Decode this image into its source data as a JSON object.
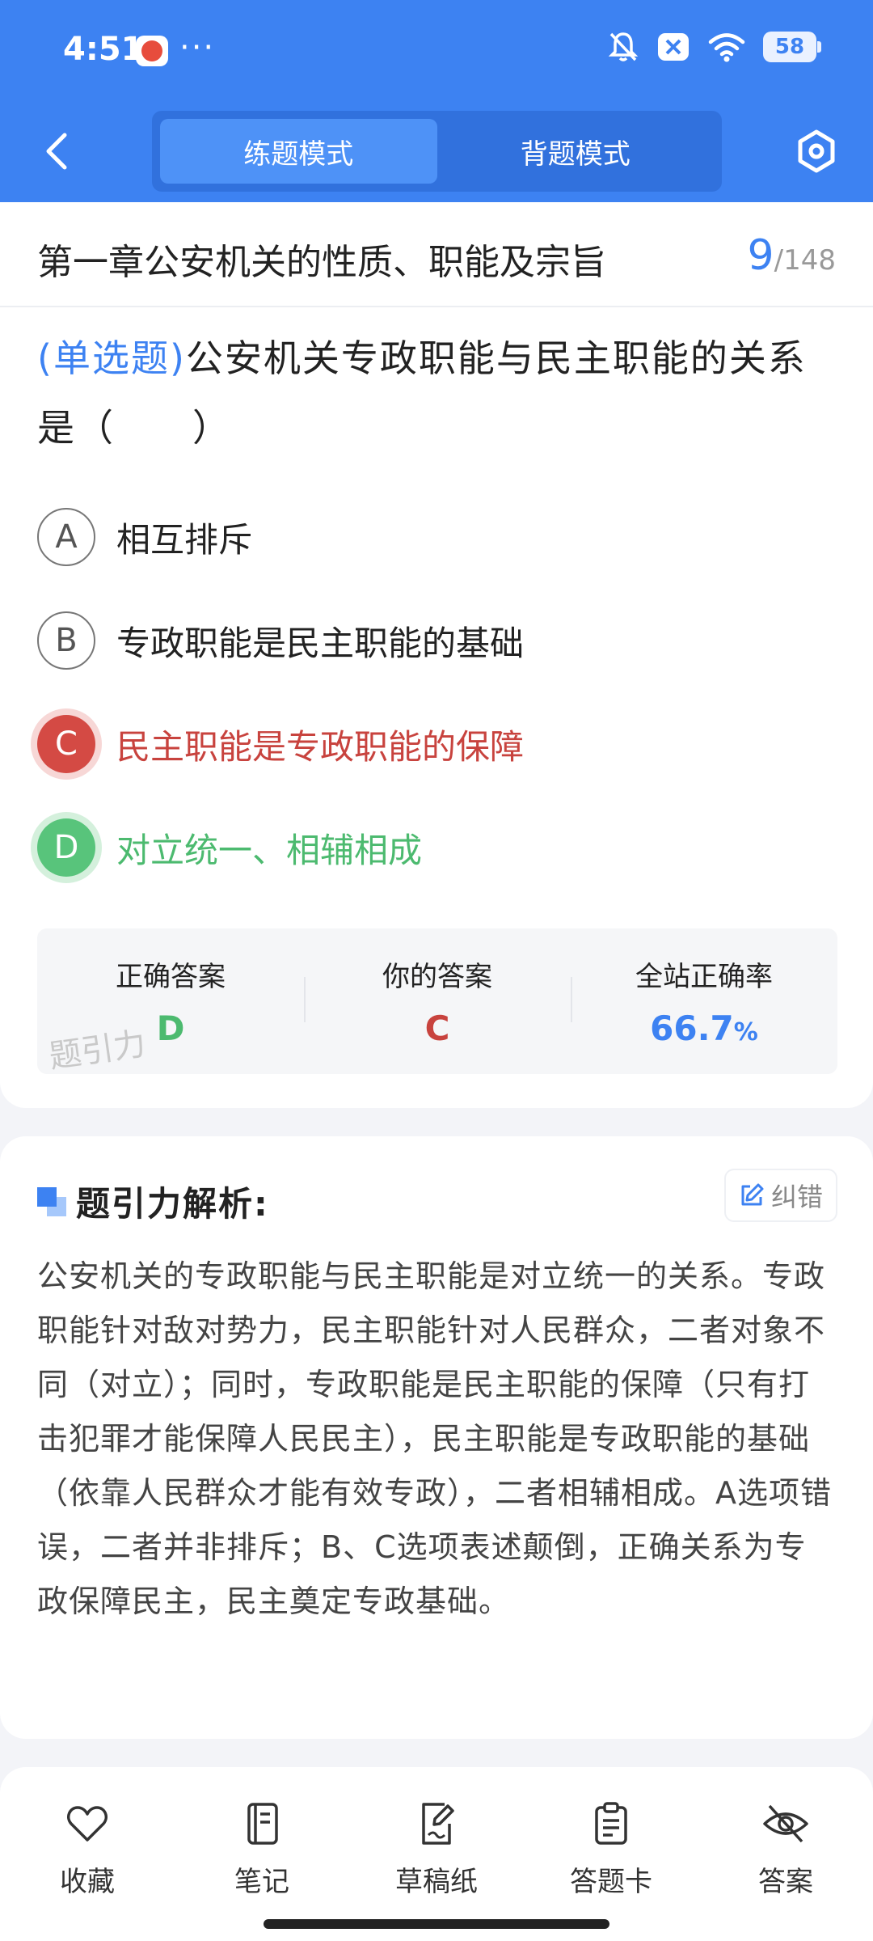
{
  "status_bar": {
    "time": "4:51",
    "more": "···",
    "battery": "58"
  },
  "nav": {
    "modes": [
      "练题模式",
      "背题模式"
    ],
    "active_mode": "练题模式"
  },
  "chapter": {
    "title": "第一章公安机关的性质、职能及宗旨",
    "current": "9",
    "total": "/148"
  },
  "question": {
    "type": "(单选题)",
    "text": "公安机关专政职能与民主职能的关系是（　　）"
  },
  "options": [
    {
      "letter": "A",
      "text": "相互排斥"
    },
    {
      "letter": "B",
      "text": "专政职能是民主职能的基础"
    },
    {
      "letter": "C",
      "text": "民主职能是专政职能的保障"
    },
    {
      "letter": "D",
      "text": "对立统一、相辅相成"
    }
  ],
  "answers": {
    "correct_label": "正确答案",
    "correct_value": "D",
    "yours_label": "你的答案",
    "yours_value": "C",
    "rate_label": "全站正确率",
    "rate_value": "66.7",
    "rate_unit": "%",
    "watermark": "题引力"
  },
  "analysis": {
    "title": "题引力解析:",
    "fix_label": "纠错",
    "body": "公安机关的专政职能与民主职能是对立统一的关系。专政职能针对敌对势力，民主职能针对人民群众，二者对象不同（对立）；同时，专政职能是民主职能的保障（只有打击犯罪才能保障人民民主），民主职能是专政职能的基础（依靠人民群众才能有效专政），二者相辅相成。A选项错误，二者并非排斥；B、C选项表述颠倒，正确关系为专政保障民主，民主奠定专政基础。"
  },
  "bottom_tabs": [
    "收藏",
    "笔记",
    "草稿纸",
    "答题卡",
    "答案"
  ],
  "colors": {
    "primary": "#3d82f2",
    "wrong": "#d44a44",
    "right": "#58c47b"
  }
}
